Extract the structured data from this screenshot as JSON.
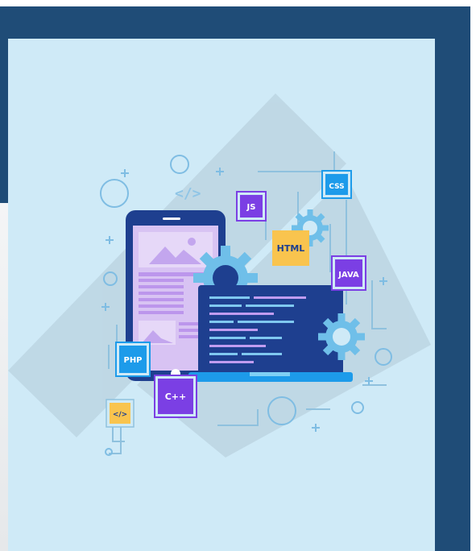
{
  "illustration": {
    "tags": {
      "css": "CSS",
      "js": "JS",
      "html": "HTML",
      "java": "JAVA",
      "php": "PHP",
      "cpp": "C++",
      "code_small": "</>",
      "code_float": "</>"
    },
    "colors": {
      "frame_navy": "#1f4c77",
      "card_bg": "#cfeaf7",
      "device_blue": "#1e3f8f",
      "purple": "#7b3fe4",
      "yellow": "#f9c44e",
      "light_blue": "#1d9bea",
      "gear": "#6fbfe9"
    }
  }
}
